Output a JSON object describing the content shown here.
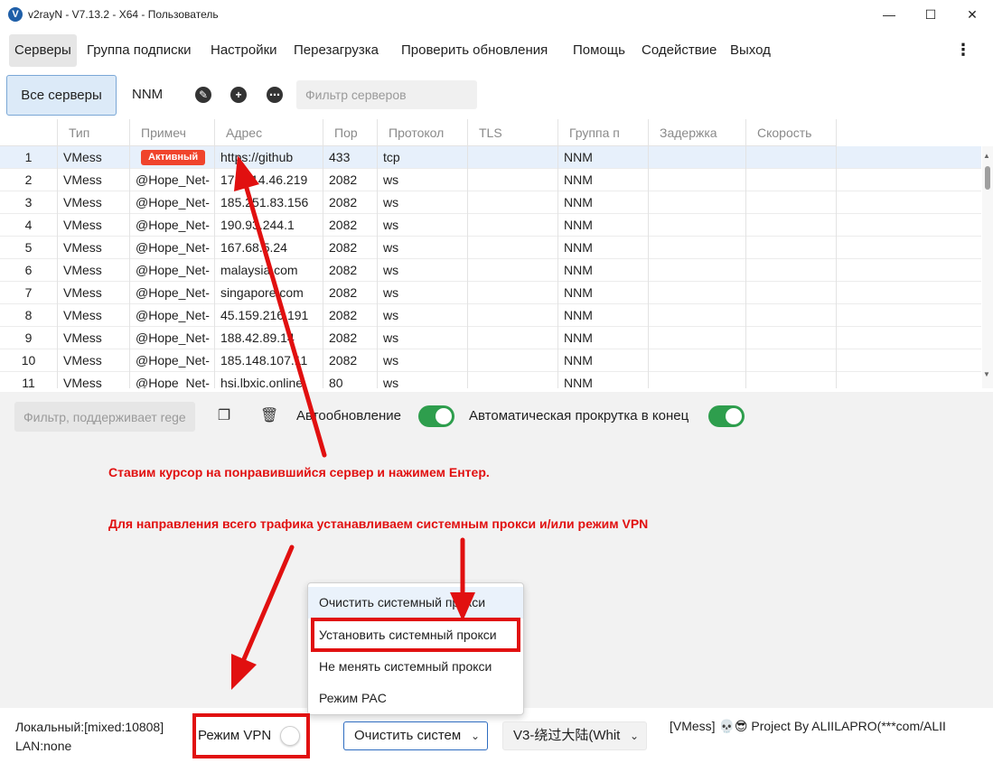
{
  "window": {
    "title": "v2rayN - V7.13.2 - X64 - Пользователь",
    "icon": "v2rayn-logo-icon",
    "minimize": "—",
    "maximize": "☐",
    "close": "✕"
  },
  "menu": {
    "items": [
      "Серверы",
      "Группа подписки",
      "Настройки",
      "Перезагрузка",
      "Проверить обновления",
      "Помощь",
      "Содействие",
      "Выход"
    ],
    "more": "⋮"
  },
  "toolbar": {
    "all_servers": "Все серверы",
    "group_tab": "NNM",
    "filter_placeholder": "Фильтр серверов",
    "icons": [
      "edit-icon",
      "add-icon",
      "more-icon"
    ]
  },
  "table": {
    "columns": [
      "Тип",
      "Примеч",
      "Адрес",
      "Пор",
      "Протокол",
      "TLS",
      "Группа п",
      "Задержка",
      "Скорость"
    ],
    "active_badge": "Активный",
    "rows": [
      {
        "num": "1",
        "type": "VMess",
        "remark": "",
        "active": true,
        "address": "https://github",
        "port": "433",
        "protocol": "tcp",
        "tls": "",
        "group": "NNM"
      },
      {
        "num": "2",
        "type": "VMess",
        "remark": "@Hope_Net-",
        "active": false,
        "address": "172.114.46.219",
        "port": "2082",
        "protocol": "ws",
        "tls": "",
        "group": "NNM"
      },
      {
        "num": "3",
        "type": "VMess",
        "remark": "@Hope_Net-",
        "active": false,
        "address": "185.251.83.156",
        "port": "2082",
        "protocol": "ws",
        "tls": "",
        "group": "NNM"
      },
      {
        "num": "4",
        "type": "VMess",
        "remark": "@Hope_Net-",
        "active": false,
        "address": "190.93.244.1",
        "port": "2082",
        "protocol": "ws",
        "tls": "",
        "group": "NNM"
      },
      {
        "num": "5",
        "type": "VMess",
        "remark": "@Hope_Net-",
        "active": false,
        "address": "167.68.5.24",
        "port": "2082",
        "protocol": "ws",
        "tls": "",
        "group": "NNM"
      },
      {
        "num": "6",
        "type": "VMess",
        "remark": "@Hope_Net-",
        "active": false,
        "address": "malaysia.com",
        "port": "2082",
        "protocol": "ws",
        "tls": "",
        "group": "NNM"
      },
      {
        "num": "7",
        "type": "VMess",
        "remark": "@Hope_Net-",
        "active": false,
        "address": "singapore.com",
        "port": "2082",
        "protocol": "ws",
        "tls": "",
        "group": "NNM"
      },
      {
        "num": "8",
        "type": "VMess",
        "remark": "@Hope_Net-",
        "active": false,
        "address": "45.159.216.191",
        "port": "2082",
        "protocol": "ws",
        "tls": "",
        "group": "NNM"
      },
      {
        "num": "9",
        "type": "VMess",
        "remark": "@Hope_Net-",
        "active": false,
        "address": "188.42.89.14",
        "port": "2082",
        "protocol": "ws",
        "tls": "",
        "group": "NNM"
      },
      {
        "num": "10",
        "type": "VMess",
        "remark": "@Hope_Net-",
        "active": false,
        "address": "185.148.107.11",
        "port": "2082",
        "protocol": "ws",
        "tls": "",
        "group": "NNM"
      },
      {
        "num": "11",
        "type": "VMess",
        "remark": "@Hope_Net-",
        "active": false,
        "address": "hsi.lbxic.online",
        "port": "80",
        "protocol": "ws",
        "tls": "",
        "group": "NNM"
      }
    ]
  },
  "log": {
    "filter_placeholder": "Фильтр, поддерживает regex",
    "copy_icon": "copy-icon",
    "delete_icon": "trash-icon",
    "autorefresh_label": "Автообновление",
    "autoscroll_label": "Автоматическая прокрутка в конец"
  },
  "annotations": {
    "line1": "Ставим курсор на понравившийся сервер и нажимем Ентер.",
    "line2": "Для направления всего трафика устанавливаем системным прокси и/или режим VPN",
    "color": "#e11010"
  },
  "popup": {
    "items": [
      "Очистить системный прокси",
      "Установить системный прокси",
      "Не менять системный прокси",
      "Режим PAC"
    ]
  },
  "status": {
    "local": "Локальный:[mixed:10808]",
    "lan": "LAN:none",
    "vpn_label": "Режим VPN",
    "proxy_select": "Очистить систем",
    "routing_select": "V3-绕过大陆(Whit",
    "right_text": "[VMess] 💀😎 Project By ALIILAPRO(***com/ALII"
  },
  "colors": {
    "accent": "#2e9e4d",
    "badge": "#f0442c",
    "selection": "#e7f0fb"
  }
}
